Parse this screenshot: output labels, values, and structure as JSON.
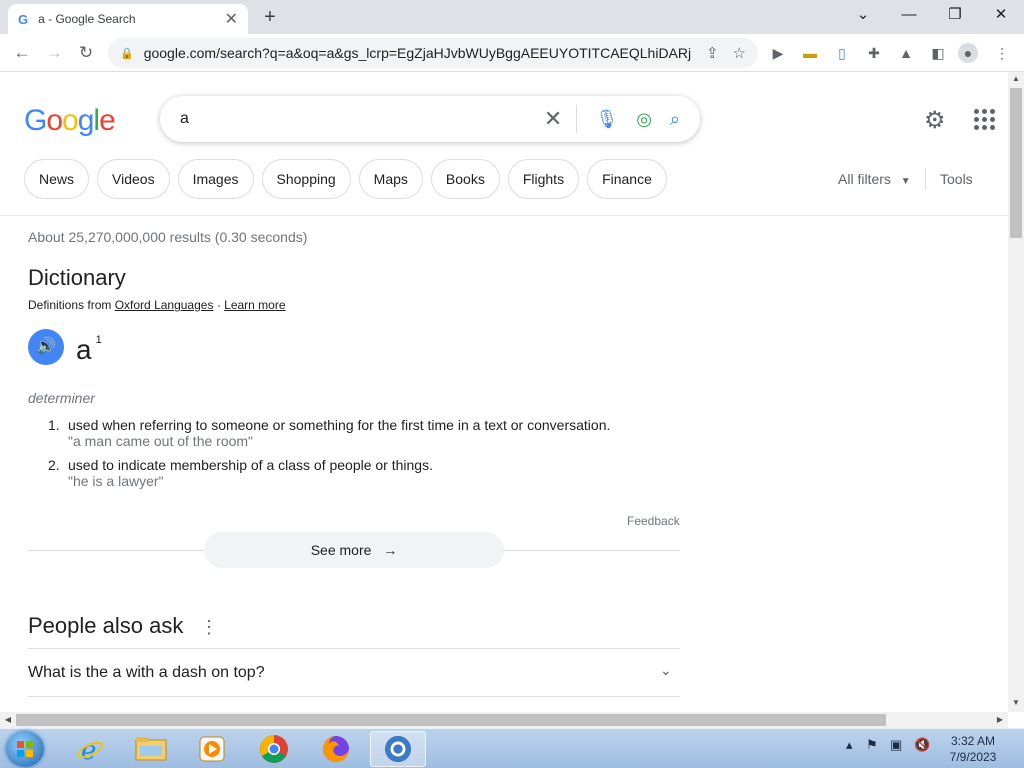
{
  "browser": {
    "tab_title": "a - Google Search",
    "tab_favicon": "G",
    "new_tab_label": "+",
    "url": "google.com/search?q=a&oq=a&gs_lcrp=EgZjaHJvbWUyBggAEEUYOTITCAEQLhiDARjHARi...",
    "window_controls": [
      "chevron-down",
      "minimize",
      "restore",
      "close"
    ]
  },
  "search": {
    "logo": "Google",
    "query": "a",
    "colors": {
      "blue": "#4285f4",
      "red": "#ea4335",
      "yellow": "#fbbc05",
      "green": "#34a853"
    }
  },
  "chips": [
    "News",
    "Videos",
    "Images",
    "Shopping",
    "Maps",
    "Books",
    "Flights",
    "Finance"
  ],
  "filters": {
    "all_filters": "All filters",
    "tools": "Tools"
  },
  "results": {
    "stats": "About 25,270,000,000 results (0.30 seconds)",
    "dictionary": {
      "title": "Dictionary",
      "source_prefix": "Definitions from",
      "source_link": "Oxford Languages",
      "separator": "·",
      "learn_more": "Learn more",
      "headword": "a",
      "superscript": "1",
      "part_of_speech": "determiner",
      "definitions": [
        {
          "num": "1.",
          "text": "used when referring to someone or something for the first time in a text or conversation.",
          "example": "\"a man came out of the room\""
        },
        {
          "num": "2.",
          "text": "used to indicate membership of a class of people or things.",
          "example": "\"he is a lawyer\""
        }
      ],
      "feedback": "Feedback",
      "see_more": "See more"
    },
    "people_also_ask": {
      "title": "People also ask",
      "questions": [
        "What is the a with a dash on top?"
      ]
    }
  },
  "taskbar": {
    "time": "3:32 AM",
    "date": "7/9/2023"
  }
}
